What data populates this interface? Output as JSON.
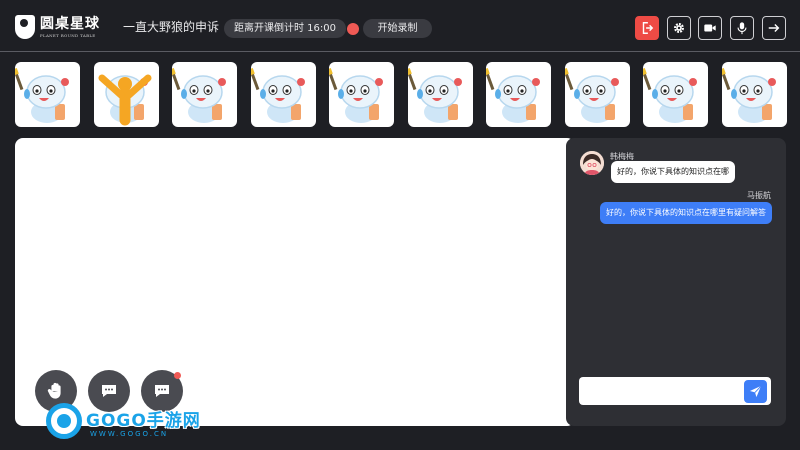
{
  "header": {
    "logo_cn": "圆桌星球",
    "logo_en": "PLANET ROUND TABLE",
    "room_title": "一直大野狼的申诉",
    "timer": "距离开课倒计时 16:00",
    "record_label": "开始录制"
  },
  "toolbar": {
    "exit_icon": "exit-icon",
    "settings_icon": "gear-icon",
    "camera_icon": "video-camera-icon",
    "mic_icon": "microphone-icon",
    "forward_icon": "arrow-right-icon",
    "exit_color": "#ee4b45"
  },
  "tiles": [
    {
      "avatar": "astronaut-mascot"
    },
    {
      "avatar": "hand-raised-figure"
    },
    {
      "avatar": "astronaut-mascot"
    },
    {
      "avatar": "astronaut-mascot"
    },
    {
      "avatar": "astronaut-mascot"
    },
    {
      "avatar": "astronaut-mascot"
    },
    {
      "avatar": "astronaut-mascot"
    },
    {
      "avatar": "astronaut-mascot"
    },
    {
      "avatar": "astronaut-mascot"
    },
    {
      "avatar": "astronaut-mascot"
    }
  ],
  "actions": {
    "raise_hand_icon": "raise-hand-icon",
    "chat_icon": "chat-bubble-icon",
    "notify_color": "#f05a55"
  },
  "chat": {
    "messages": [
      {
        "name": "韩梅梅",
        "text": "好的，你说下具体的知识点在哪",
        "side": "in"
      },
      {
        "name": "马振航",
        "text": "好的，你说下具体的知识点在哪里有疑问解答",
        "side": "out"
      }
    ],
    "input_value": "",
    "send_icon": "send-icon",
    "accent": "#3e7ef7"
  },
  "watermark": {
    "name": "GOGO手游网",
    "url": "WWW.GOGO.CN"
  }
}
